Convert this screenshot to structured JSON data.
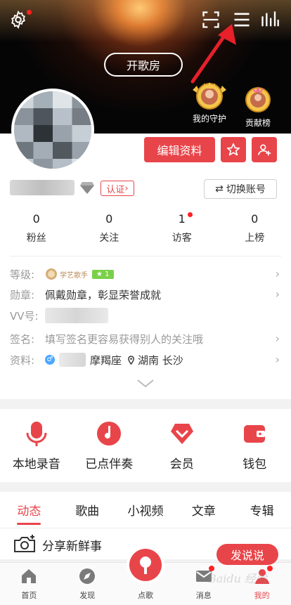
{
  "header": {
    "kge_button": "开歌房",
    "badges": [
      {
        "label": "我的守护"
      },
      {
        "label": "贡献榜"
      }
    ]
  },
  "profile": {
    "edit_button": "编辑资料",
    "cert_label": "认证",
    "switch_account": "切换账号",
    "stats": [
      {
        "value": "0",
        "label": "粉丝"
      },
      {
        "value": "0",
        "label": "关注"
      },
      {
        "value": "1",
        "label": "访客"
      },
      {
        "value": "0",
        "label": "上榜"
      }
    ],
    "info": {
      "grade_label": "等级:",
      "grade_title": "学艺歌手",
      "grade_level": "1",
      "medal_label": "勋章:",
      "medal_value": "佩戴勋章，彰显荣誉成就",
      "vv_label": "VV号:",
      "sign_label": "签名:",
      "sign_value": "填写签名更容易获得别人的关注哦",
      "data_label": "资料:",
      "constellation": "摩羯座",
      "location": "湖南 长沙"
    }
  },
  "quick_actions": [
    {
      "label": "本地录音",
      "icon": "mic-icon"
    },
    {
      "label": "已点伴奏",
      "icon": "music-note-icon"
    },
    {
      "label": "会员",
      "icon": "vip-heart-icon"
    },
    {
      "label": "钱包",
      "icon": "wallet-icon"
    }
  ],
  "tabs": [
    {
      "label": "动态",
      "active": true
    },
    {
      "label": "歌曲"
    },
    {
      "label": "小视频"
    },
    {
      "label": "文章"
    },
    {
      "label": "专辑"
    }
  ],
  "share": {
    "text": "分享新鲜事",
    "button": "发说说"
  },
  "bottom_nav": [
    {
      "label": "首页"
    },
    {
      "label": "发现"
    },
    {
      "label": "点歌"
    },
    {
      "label": "消息"
    },
    {
      "label": "我的"
    }
  ],
  "watermark": "Baidu 经验",
  "colors": {
    "accent": "#e8454a",
    "header_bg": "#050506"
  }
}
